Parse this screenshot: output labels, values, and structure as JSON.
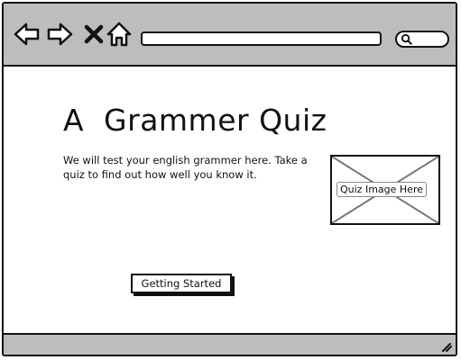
{
  "browser": {
    "toolbar": {
      "back_icon": "arrow-left-icon",
      "forward_icon": "arrow-right-icon",
      "close_icon": "close-icon",
      "home_icon": "home-icon",
      "search_icon": "search-icon"
    },
    "address_bar": {
      "value": ""
    },
    "search_field": {
      "value": ""
    }
  },
  "page": {
    "title": "A  Grammer Quiz",
    "description": "We will test your english grammer here. Take a quiz to find out how well you know it.",
    "image_placeholder": {
      "label": "Quiz Image Here"
    },
    "button": {
      "label": "Getting Started"
    }
  },
  "colors": {
    "chrome": "#bdbdbd",
    "stroke": "#111111",
    "background": "#ffffff",
    "placeholder_cross": "#777777"
  }
}
